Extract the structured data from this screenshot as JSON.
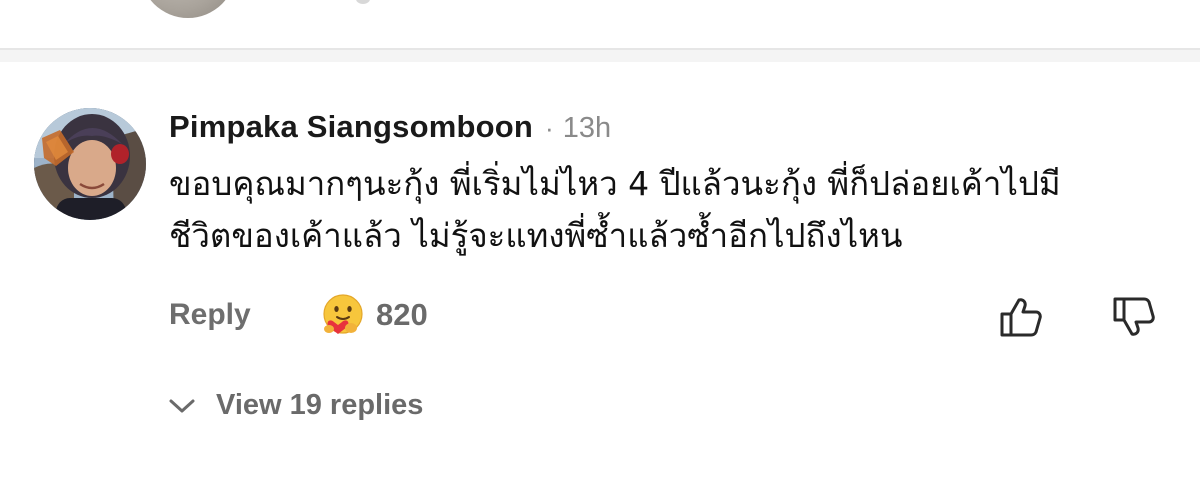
{
  "comment": {
    "author": "Pimpaka Siangsomboon",
    "separator": "·",
    "time": "13h",
    "text_line1": "ขอบคุณมากๆนะกุ้ง พี่เริ่มไม่ไหว 4 ปีแล้วนะกุ้ง พี่ก็ปล่อยเค้าไปมี",
    "text_line2": "ชีวิตของเค้าแล้ว ไม่รู้จะแทงพี่ซ้ำแล้วซ้ำอีกไปถึงไหน",
    "reply_label": "Reply",
    "reaction_count": "820",
    "reaction_icon": "care-emoji-icon",
    "like_icon": "thumbs-up-icon",
    "dislike_icon": "thumbs-down-icon",
    "view_replies_label": "View 19 replies",
    "expand_icon": "chevron-down-icon"
  },
  "colors": {
    "muted_text": "#6e6e6e",
    "divider": "#e6e6e6",
    "background": "#ffffff"
  }
}
